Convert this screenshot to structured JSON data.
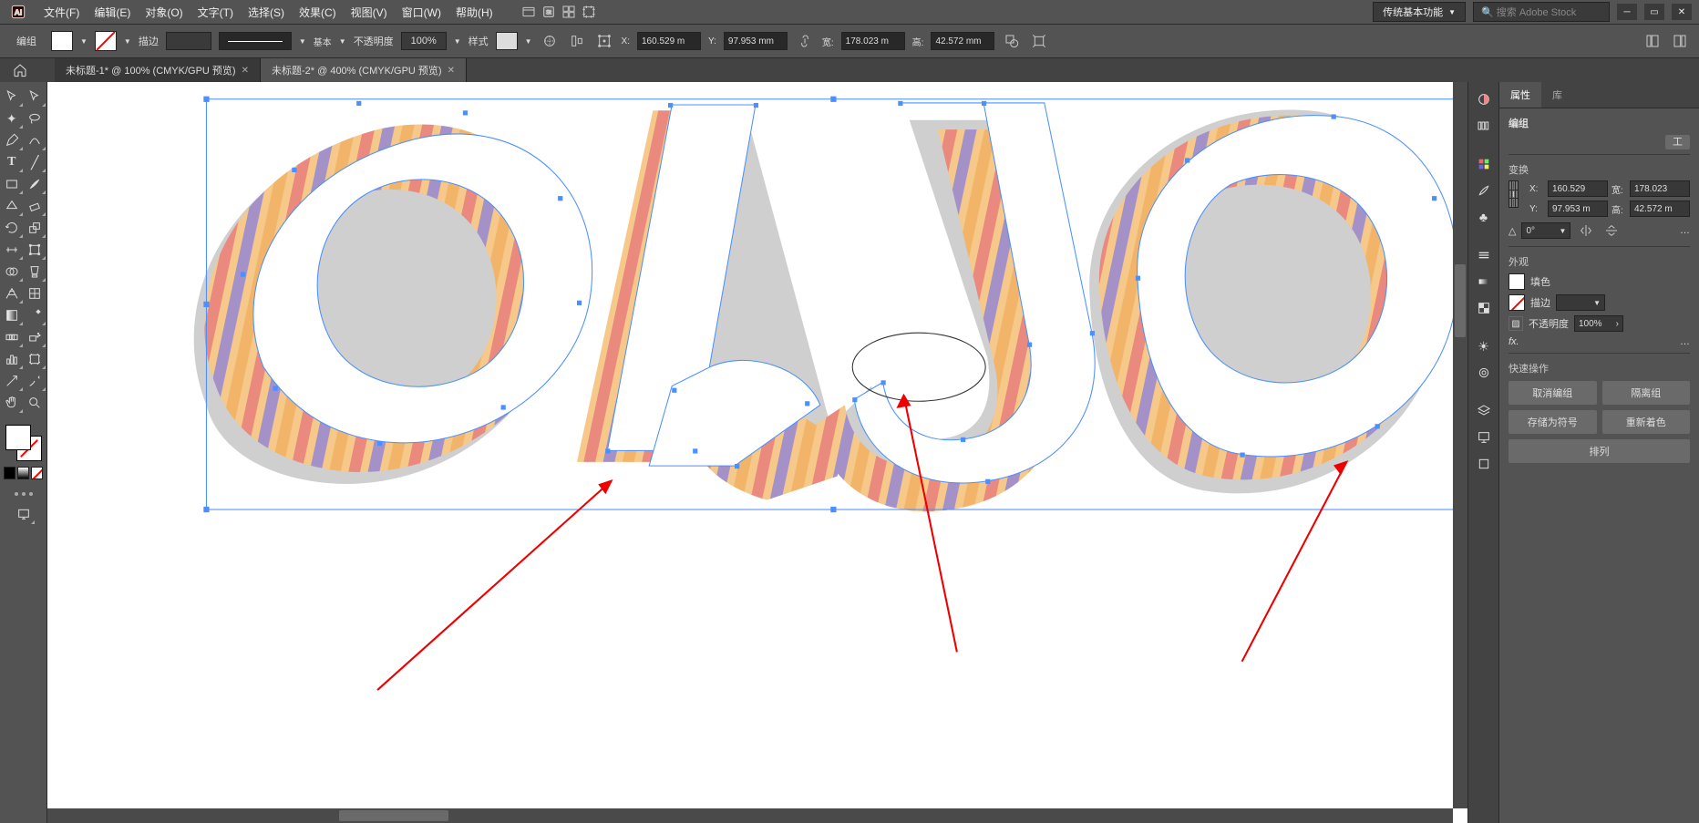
{
  "menubar": {
    "items": [
      "文件(F)",
      "编辑(E)",
      "对象(O)",
      "文字(T)",
      "选择(S)",
      "效果(C)",
      "视图(V)",
      "窗口(W)",
      "帮助(H)"
    ],
    "workspace": "传统基本功能",
    "search_placeholder": "搜索 Adobe Stock"
  },
  "controlbar": {
    "sel_label": "编组",
    "stroke_label": "描边",
    "stroke_weight": "",
    "brush_style": "基本",
    "opacity_label": "不透明度",
    "opacity": "100%",
    "style_label": "样式",
    "x_label": "X:",
    "x_value": "160.529 m",
    "y_label": "Y:",
    "y_value": "97.953 mm",
    "w_label": "宽:",
    "w_value": "178.023 m",
    "h_label": "高:",
    "h_value": "42.572 mm"
  },
  "tabs": [
    {
      "label": "未标题-1* @ 100% (CMYK/GPU 预览)",
      "active": false
    },
    {
      "label": "未标题-2* @ 400% (CMYK/GPU 预览)",
      "active": true
    }
  ],
  "properties": {
    "tabs": {
      "properties": "属性",
      "library": "库"
    },
    "object_type": "编组",
    "sections": {
      "transform": "变换",
      "appearance": "外观",
      "quick_actions": "快速操作"
    },
    "transform": {
      "x_label": "X:",
      "x_value": "160.529",
      "y_label": "Y:",
      "y_value": "97.953 m",
      "w_label": "宽:",
      "w_value": "178.023",
      "h_label": "高:",
      "h_value": "42.572 m",
      "angle_label": "△",
      "angle_value": "0°"
    },
    "appearance": {
      "fill_label": "填色",
      "stroke_label": "描边",
      "stroke_weight": "",
      "opacity_label": "不透明度",
      "opacity": "100%",
      "fx_label": "fx."
    },
    "buttons": {
      "ungroup": "取消编组",
      "isolate": "隔离组",
      "save_symbol": "存储为符号",
      "recolor": "重新着色",
      "arrange": "排列"
    },
    "more": "…",
    "edit_btn": "工"
  }
}
